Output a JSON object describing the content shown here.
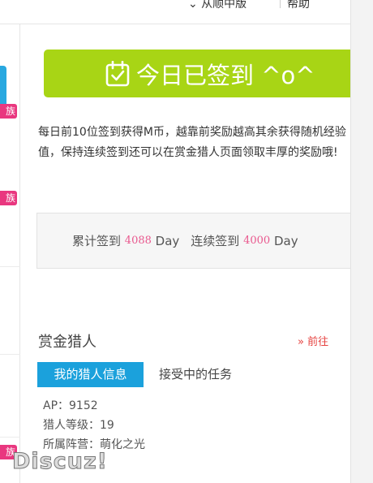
{
  "header": {
    "link_a": "⌄ 从顺中版",
    "link_b": "帮助"
  },
  "sidebar": {
    "badge_text": "族"
  },
  "sign": {
    "button_label": "今日已签到 ^o^"
  },
  "description": "每日前10位签到获得M币，越靠前奖励越高其余获得随机经验值，保持连续签到还可以在赏金猎人页面领取丰厚的奖励哦!",
  "stats": {
    "total_label": "累计签到",
    "total_value": "4088",
    "total_unit": "Day",
    "streak_label": "连续签到",
    "streak_value": "4000",
    "streak_unit": "Day"
  },
  "hunter": {
    "title": "赏金猎人",
    "more_link": "» 前往",
    "tabs": [
      {
        "label": "我的猎人信息"
      },
      {
        "label": "接受中的任务"
      }
    ],
    "info": {
      "ap": "AP：9152",
      "level": "猎人等级：19",
      "camp": "所属阵营：萌化之光"
    }
  },
  "watermark": "Discuz!",
  "colors": {
    "sign_button": "#a8d515",
    "tab_active": "#1ba1dc",
    "badge": "#e9377f",
    "number_accent": "#e9588e",
    "link_red": "#e64340"
  }
}
